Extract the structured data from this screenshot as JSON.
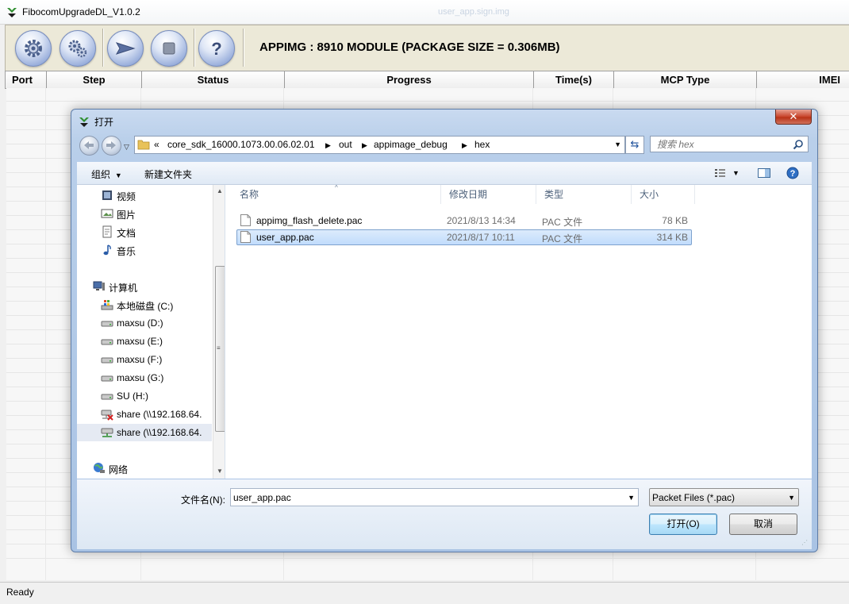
{
  "app": {
    "title": "FibocomUpgradeDL_V1.0.2",
    "ghost_title": "user_app.sign.img",
    "package_label": "APPIMG : 8910 MODULE (PACKAGE SIZE = 0.306MB)",
    "status": "Ready"
  },
  "toolbar": {
    "buttons": [
      {
        "icon": "gear-icon"
      },
      {
        "icon": "gears-icon"
      },
      {
        "icon": "send-arrow-icon"
      },
      {
        "icon": "stop-icon"
      },
      {
        "icon": "help-icon"
      }
    ]
  },
  "grid": {
    "columns": [
      "Port",
      "Step",
      "Status",
      "Progress",
      "Time(s)",
      "MCP Type",
      "IMEI"
    ]
  },
  "dialog": {
    "title": "打开",
    "breadcrumb": {
      "prefix": "«",
      "parts": [
        "core_sdk_16000.1073.00.06.02.01",
        "out",
        "appimage_debug",
        "hex"
      ]
    },
    "search_placeholder": "搜索 hex",
    "commands": {
      "organize": "组织",
      "new_folder": "新建文件夹"
    },
    "nav_items": [
      {
        "label": "视频",
        "icon": "video-library-icon"
      },
      {
        "label": "图片",
        "icon": "pictures-library-icon"
      },
      {
        "label": "文档",
        "icon": "documents-library-icon"
      },
      {
        "label": "音乐",
        "icon": "music-library-icon"
      },
      {
        "label": "计算机",
        "icon": "computer-icon"
      },
      {
        "label": "本地磁盘 (C:)",
        "icon": "system-drive-icon"
      },
      {
        "label": "maxsu (D:)",
        "icon": "drive-icon"
      },
      {
        "label": "maxsu (E:)",
        "icon": "drive-icon"
      },
      {
        "label": "maxsu (F:)",
        "icon": "drive-icon"
      },
      {
        "label": "maxsu (G:)",
        "icon": "drive-icon"
      },
      {
        "label": "SU (H:)",
        "icon": "drive-icon"
      },
      {
        "label": "share (\\\\192.168.64.",
        "icon": "network-drive-disconnected-icon"
      },
      {
        "label": "share (\\\\192.168.64.",
        "icon": "network-drive-icon"
      },
      {
        "label": "网络",
        "icon": "network-icon"
      }
    ],
    "columns": {
      "name": "名称",
      "date": "修改日期",
      "type": "类型",
      "size": "大小"
    },
    "files": [
      {
        "name": "appimg_flash_delete.pac",
        "date": "2021/8/13 14:34",
        "type": "PAC 文件",
        "size": "78 KB"
      },
      {
        "name": "user_app.pac",
        "date": "2021/8/17 10:11",
        "type": "PAC 文件",
        "size": "314 KB"
      }
    ],
    "filename_label": "文件名(N):",
    "filename_value": "user_app.pac",
    "filter": "Packet Files (*.pac)",
    "open_button": "打开(O)",
    "cancel_button": "取消"
  }
}
